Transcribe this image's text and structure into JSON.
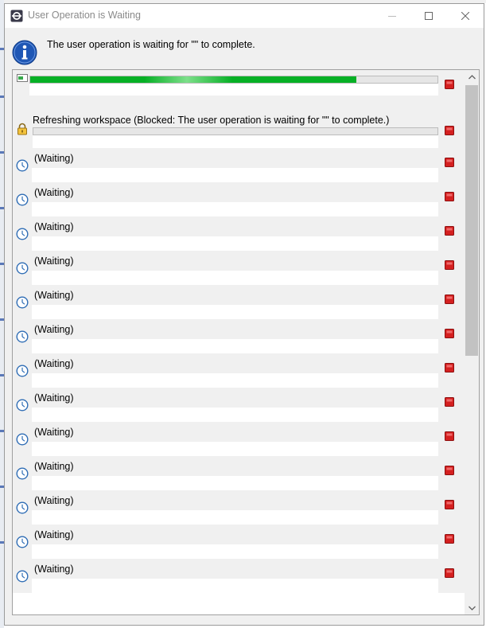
{
  "window": {
    "title": "User Operation is Waiting"
  },
  "message": "The user operation is waiting for \"\" to complete.",
  "jobs": {
    "active": {
      "progress_percent": 80
    },
    "blocked": {
      "label": "Refreshing workspace (Blocked: The user operation is waiting for \"\" to complete.)"
    },
    "waiting_label": "(Waiting)",
    "waiting_count": 13
  },
  "colors": {
    "progress": "#06b025",
    "stop": "#d42020",
    "clock": "#2f6db5"
  },
  "icons": {
    "info": "info-icon",
    "lock": "lock-icon",
    "clock": "clock-icon",
    "stop": "stop-icon"
  }
}
